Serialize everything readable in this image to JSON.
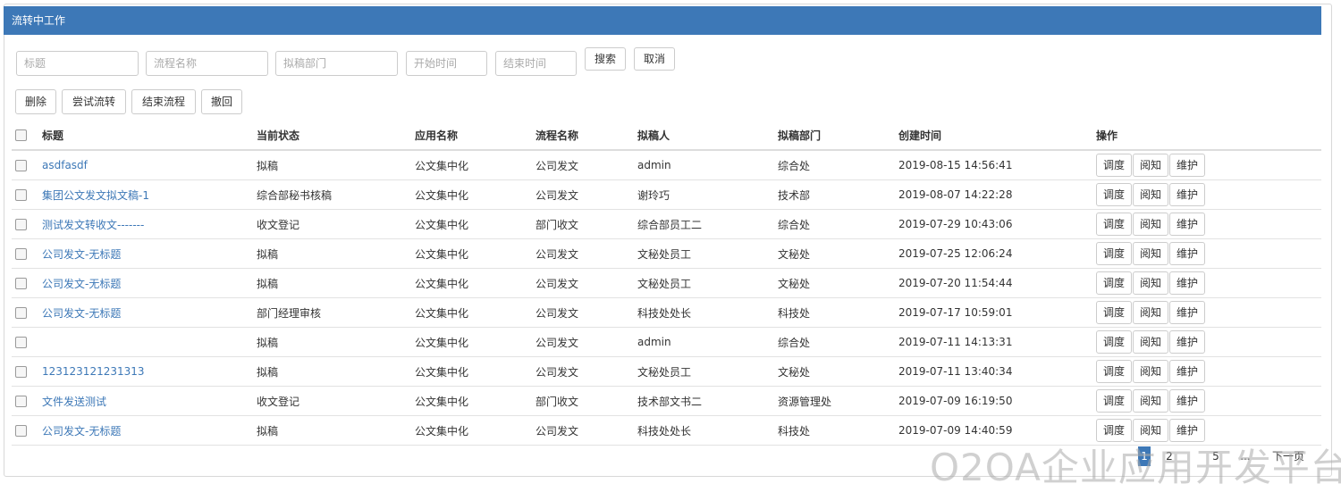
{
  "header": {
    "title": "流转中工作"
  },
  "search": {
    "title_placeholder": "标题",
    "process_placeholder": "流程名称",
    "dept_placeholder": "拟稿部门",
    "start_placeholder": "开始时间",
    "end_placeholder": "结束时间",
    "search_label": "搜索",
    "cancel_label": "取消"
  },
  "toolbar": {
    "delete_label": "删除",
    "try_flow_label": "尝试流转",
    "end_flow_label": "结束流程",
    "revoke_label": "撤回"
  },
  "table": {
    "columns": [
      "标题",
      "当前状态",
      "应用名称",
      "流程名称",
      "拟稿人",
      "拟稿部门",
      "创建时间",
      "操作"
    ],
    "actions": [
      "调度",
      "阅知",
      "维护"
    ],
    "rows": [
      {
        "title": "asdfasdf",
        "status": "拟稿",
        "app": "公文集中化",
        "process": "公司发文",
        "drafter": "admin",
        "dept": "综合处",
        "created": "2019-08-15 14:56:41"
      },
      {
        "title": "集团公文发文拟文稿-1",
        "status": "综合部秘书核稿",
        "app": "公文集中化",
        "process": "公司发文",
        "drafter": "谢玲巧",
        "dept": "技术部",
        "created": "2019-08-07 14:22:28"
      },
      {
        "title": "测试发文转收文-------",
        "status": "收文登记",
        "app": "公文集中化",
        "process": "部门收文",
        "drafter": "综合部员工二",
        "dept": "综合处",
        "created": "2019-07-29 10:43:06"
      },
      {
        "title": "公司发文-无标题",
        "status": "拟稿",
        "app": "公文集中化",
        "process": "公司发文",
        "drafter": "文秘处员工",
        "dept": "文秘处",
        "created": "2019-07-25 12:06:24"
      },
      {
        "title": "公司发文-无标题",
        "status": "拟稿",
        "app": "公文集中化",
        "process": "公司发文",
        "drafter": "文秘处员工",
        "dept": "文秘处",
        "created": "2019-07-20 11:54:44"
      },
      {
        "title": "公司发文-无标题",
        "status": "部门经理审核",
        "app": "公文集中化",
        "process": "公司发文",
        "drafter": "科技处处长",
        "dept": "科技处",
        "created": "2019-07-17 10:59:01"
      },
      {
        "title": "",
        "status": "拟稿",
        "app": "公文集中化",
        "process": "公司发文",
        "drafter": "admin",
        "dept": "综合处",
        "created": "2019-07-11 14:13:31"
      },
      {
        "title": "123123121231313",
        "status": "拟稿",
        "app": "公文集中化",
        "process": "公司发文",
        "drafter": "文秘处员工",
        "dept": "文秘处",
        "created": "2019-07-11 13:40:34"
      },
      {
        "title": "文件发送测试",
        "status": "收文登记",
        "app": "公文集中化",
        "process": "部门收文",
        "drafter": "技术部文书二",
        "dept": "资源管理处",
        "created": "2019-07-09 16:19:50"
      },
      {
        "title": "公司发文-无标题",
        "status": "拟稿",
        "app": "公文集中化",
        "process": "公司发文",
        "drafter": "科技处处长",
        "dept": "科技处",
        "created": "2019-07-09 14:40:59"
      }
    ]
  },
  "pagination": {
    "current": "1",
    "page2": "2",
    "page5": "5",
    "ellipsis": "...",
    "next": "下一页"
  },
  "watermark": "O2OA企业应用开发平台",
  "colors": {
    "accent": "#3d78b7",
    "link": "#3d78b7"
  }
}
